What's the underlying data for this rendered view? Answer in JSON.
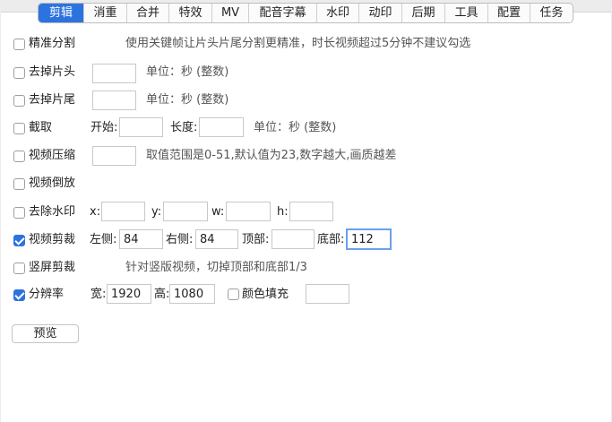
{
  "tabs": [
    "剪辑",
    "消重",
    "合并",
    "特效",
    "MV",
    "配音字幕",
    "水印",
    "动印",
    "后期",
    "工具",
    "配置",
    "任务"
  ],
  "active_tab": 0,
  "options": {
    "precise_split": {
      "label": "精准分割",
      "checked": false,
      "hint": "使用关键帧让片头片尾分割更精准，时长视频超过5分钟不建议勾选"
    },
    "remove_head": {
      "label": "去掉片头",
      "checked": false,
      "value": "",
      "unit": "单位：秒 (整数)"
    },
    "remove_tail": {
      "label": "去掉片尾",
      "checked": false,
      "value": "",
      "unit": "单位：秒 (整数)"
    },
    "clip": {
      "label": "截取",
      "checked": false,
      "start_label": "开始:",
      "start_value": "",
      "length_label": "长度:",
      "length_value": "",
      "unit": "单位：秒 (整数)"
    },
    "compress": {
      "label": "视频压缩",
      "checked": false,
      "value": "",
      "hint": "取值范围是0-51,默认值为23,数字越大,画质越差"
    },
    "reverse": {
      "label": "视频倒放",
      "checked": false
    },
    "dewatermark": {
      "label": "去除水印",
      "checked": false,
      "x_label": "x:",
      "x_value": "",
      "y_label": "y:",
      "y_value": "",
      "w_label": "w:",
      "w_value": "",
      "h_label": "h:",
      "h_value": ""
    },
    "crop": {
      "label": "视频剪裁",
      "checked": true,
      "left_label": "左侧:",
      "left_value": "84",
      "right_label": "右侧:",
      "right_value": "84",
      "top_label": "顶部:",
      "top_value": "",
      "bottom_label": "底部:",
      "bottom_value": "112"
    },
    "vertical_crop": {
      "label": "竖屏剪裁",
      "checked": false,
      "hint": "针对竖版视频，切掉顶部和底部1/3"
    },
    "resolution": {
      "label": "分辨率",
      "checked": true,
      "width_label": "宽:",
      "width_value": "1920",
      "height_label": "高:",
      "height_value": "1080",
      "fill_label": "颜色填充",
      "fill_checked": false,
      "fill_value": ""
    }
  },
  "preview_button": "预览",
  "colors": {
    "accent": "#2d73e0",
    "focus": "#6aa0ee"
  }
}
